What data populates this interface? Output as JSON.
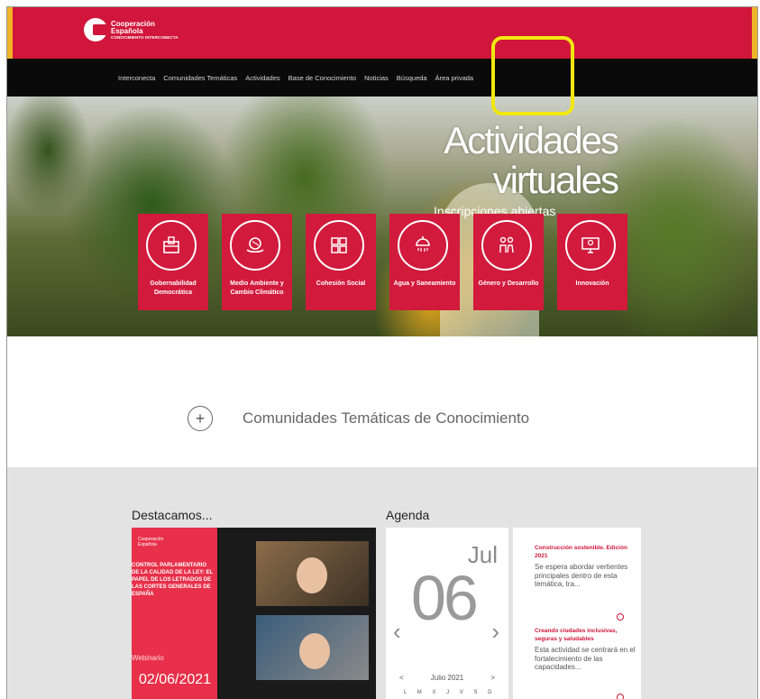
{
  "header": {
    "logo_line1": "Cooperación",
    "logo_line2": "Española",
    "logo_sub": "CONOCIMIENTO INTERCONECTA"
  },
  "nav": {
    "items": [
      "Interconecta",
      "Comunidades Temáticas",
      "Actividades",
      "Base de Conocimiento",
      "Noticias",
      "Búsqueda",
      "Área privada"
    ]
  },
  "hero": {
    "title": "Actividades virtuales",
    "subtitle": "Inscripciones abiertas"
  },
  "categories": [
    {
      "label": "Gobernabilidad Democrática",
      "icon": "ballot-box-icon"
    },
    {
      "label": "Medio Ambiente y Cambio Climático",
      "icon": "globe-hands-icon"
    },
    {
      "label": "Cohesión Social",
      "icon": "puzzle-icon"
    },
    {
      "label": "Agua y Saneamiento",
      "icon": "shower-icon"
    },
    {
      "label": "Género y Desarrollo",
      "icon": "people-icon"
    },
    {
      "label": "Innovación",
      "icon": "monitor-bulb-icon"
    }
  ],
  "community": {
    "label": "Comunidades Temáticas de Conocimiento"
  },
  "featured": {
    "title": "Destacamos...",
    "image_small": "Cooperación Española",
    "image_text": "CONTROL PARLAMENTARIO DE LA CALIDAD DE LA LEY: EL PAPEL DE LOS LETRADOS DE LAS CORTES GENERALES DE ESPAÑA",
    "image_sem": "Webinario",
    "image_date": "02/06/2021"
  },
  "agenda": {
    "title": "Agenda",
    "month": "Jul",
    "day": "06",
    "nav_label": "Julio 2021",
    "weekdays": "L M X J V S D"
  },
  "events": [
    {
      "title": "Construcción sostenible. Edición 2021",
      "body": "Se espera abordar vertientes principales dentro de esta temática, tra..."
    },
    {
      "title": "Creando ciudades inclusivas, seguras y saludables",
      "body": "Esta actividad se centrará en el fortalecimiento de las capacidades..."
    }
  ],
  "colors": {
    "brand_red": "#d0163a",
    "highlight": "#f1e80f"
  }
}
